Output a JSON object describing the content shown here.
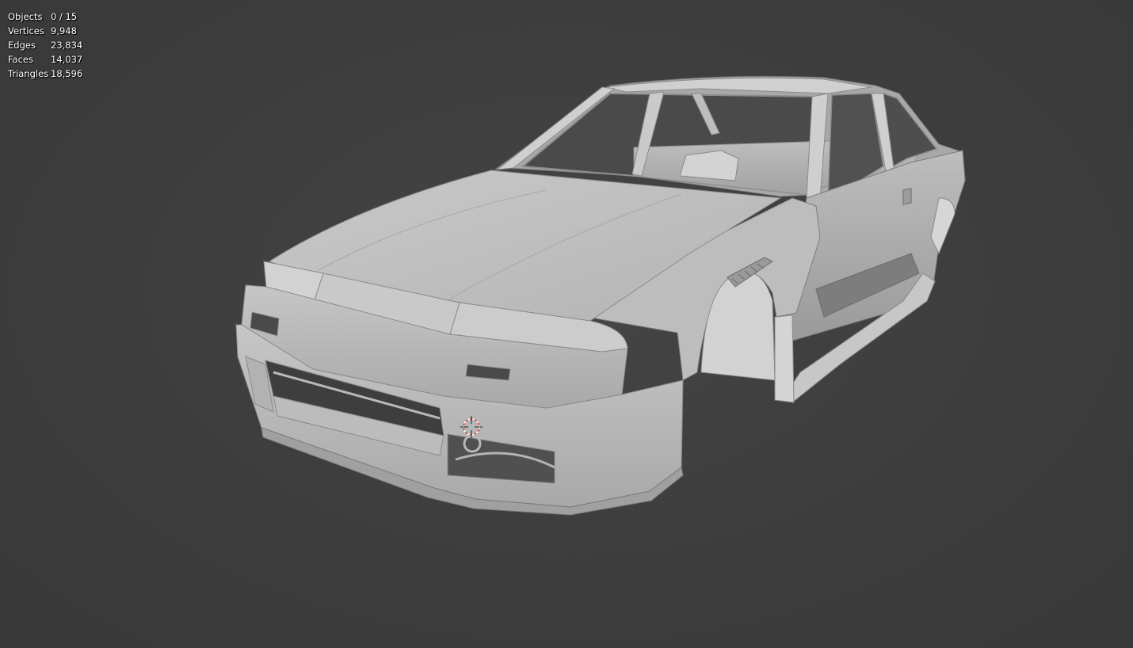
{
  "viewport": {
    "background_color": "#3d3d3d",
    "mesh_color": "#c8c8c8"
  },
  "stats": [
    {
      "label": "Objects",
      "value": "0 / 15"
    },
    {
      "label": "Vertices",
      "value": "9,948"
    },
    {
      "label": "Edges",
      "value": "23,834"
    },
    {
      "label": "Faces",
      "value": "14,037"
    },
    {
      "label": "Triangles",
      "value": "18,596"
    }
  ],
  "scene": {
    "model_name": "car-body-mesh",
    "cursor_icon": "3d-cursor-icon"
  }
}
